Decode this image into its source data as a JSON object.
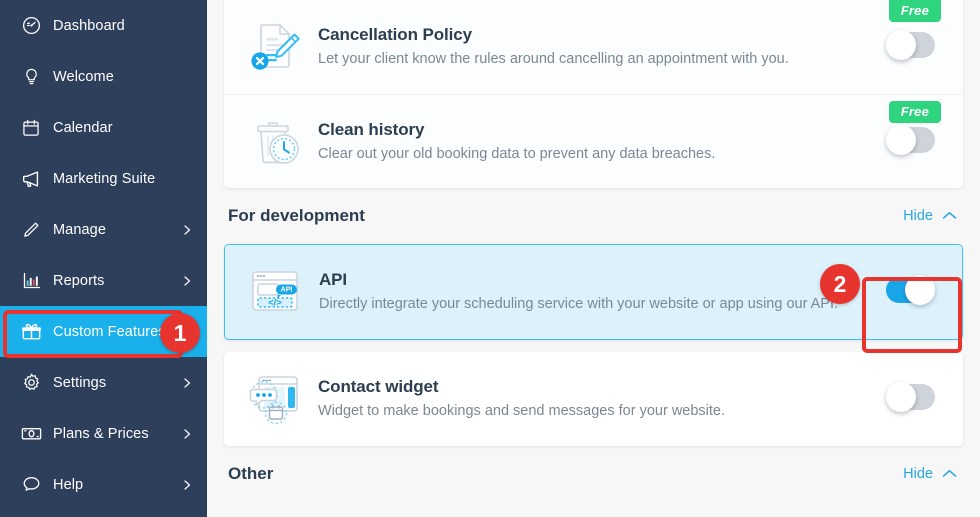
{
  "sidebar": {
    "items": [
      {
        "label": "Dashboard",
        "icon": "dashboard-gauge-icon",
        "chevron": false,
        "active": false
      },
      {
        "label": "Welcome",
        "icon": "lightbulb-icon",
        "chevron": false,
        "active": false
      },
      {
        "label": "Calendar",
        "icon": "calendar-icon",
        "chevron": false,
        "active": false
      },
      {
        "label": "Marketing Suite",
        "icon": "megaphone-icon",
        "chevron": false,
        "active": false
      },
      {
        "label": "Manage",
        "icon": "pencil-icon",
        "chevron": true,
        "active": false
      },
      {
        "label": "Reports",
        "icon": "bar-chart-icon",
        "chevron": true,
        "active": false
      },
      {
        "label": "Custom Features",
        "icon": "gift-box-icon",
        "chevron": false,
        "active": true
      },
      {
        "label": "Settings",
        "icon": "gear-icon",
        "chevron": true,
        "active": false
      },
      {
        "label": "Plans & Prices",
        "icon": "banknote-icon",
        "chevron": true,
        "active": false
      },
      {
        "label": "Help",
        "icon": "speech-bubble-icon",
        "chevron": true,
        "active": false
      }
    ]
  },
  "main": {
    "top_features": [
      {
        "title": "Cancellation Policy",
        "desc": "Let your client know the rules around cancelling an appointment with you.",
        "badge": "Free",
        "icon": "document-cancel-icon",
        "toggle_on": false
      },
      {
        "title": "Clean history",
        "desc": "Clear out your old booking data to prevent any data breaches.",
        "badge": "Free",
        "icon": "trash-clock-icon",
        "toggle_on": false
      }
    ],
    "sections": [
      {
        "title": "For development",
        "hide_label": "Hide",
        "features": [
          {
            "title": "API",
            "desc": "Directly integrate your scheduling service with your website or app using our API.",
            "icon": "api-code-window-icon",
            "toggle_on": true,
            "highlighted": true
          },
          {
            "title": "Contact widget",
            "desc": "Widget to make bookings and send messages for your website.",
            "icon": "chat-widget-icon",
            "toggle_on": false,
            "highlighted": false
          }
        ]
      },
      {
        "title": "Other",
        "hide_label": "Hide",
        "features": []
      }
    ]
  },
  "annotations": [
    {
      "number": "1",
      "target": "sidebar-item-custom-features"
    },
    {
      "number": "2",
      "target": "api-toggle"
    }
  ],
  "colors": {
    "sidebar_bg": "#2e3f5c",
    "accent_blue": "#19b0eb",
    "badge_green": "#2fd47f",
    "annotation_red": "#e8342e",
    "highlight_blue": "#ddf1fb"
  }
}
